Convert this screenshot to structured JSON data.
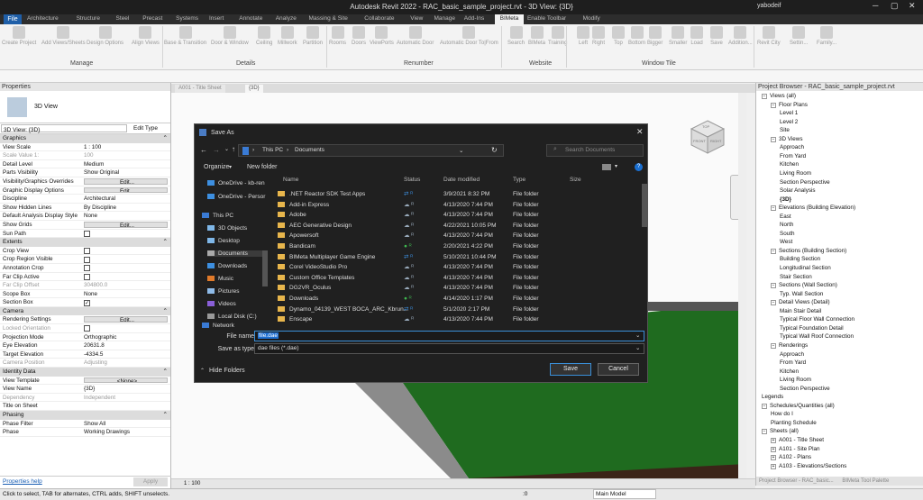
{
  "app": {
    "title": "Autodesk Revit 2022 - RAC_basic_sample_project.rvt - 3D View: {3D}",
    "user": "yabodeif"
  },
  "ribbon": {
    "file_tab": "File",
    "tabs": [
      "Architecture",
      "Structure",
      "Steel",
      "Precast",
      "Systems",
      "Insert",
      "Annotate",
      "Analyze",
      "Massing & Site",
      "Collaborate",
      "View",
      "Manage",
      "Add-Ins",
      "BIMeta",
      "Enable Toolbar",
      "Modify"
    ],
    "active_tab": "BIMeta",
    "buttons": [
      "Create Project",
      "Add Views/Sheets",
      "Design Options",
      "Align Views",
      "Base & Transition",
      "Door & Window",
      "Ceiling",
      "Millwork",
      "Partition",
      "Rooms",
      "Doors",
      "ViewPorts",
      "Automatic Door",
      "Automatic Door To|From",
      "Search",
      "BIMeta",
      "Training",
      "Left",
      "Right",
      "Top",
      "Bottom",
      "Bigger",
      "Smaller",
      "Load",
      "Save",
      "Addition...",
      "Revit City",
      "Settin...",
      "Family..."
    ],
    "panels": [
      "Manage",
      "Details",
      "Renumber",
      "Website",
      "Window Tile"
    ]
  },
  "view_tabs": [
    "A001 - Title Sheet",
    "{3D}"
  ],
  "properties": {
    "title": "Properties",
    "type_name": "3D View",
    "selector": "3D View: {3D}",
    "edit_type": "Edit Type",
    "groups": [
      {
        "name": "Graphics",
        "rows": [
          {
            "k": "View Scale",
            "v": "1 : 100"
          },
          {
            "k": "Scale Value    1:",
            "v": "100",
            "grey": true
          },
          {
            "k": "Detail Level",
            "v": "Medium"
          },
          {
            "k": "Parts Visibility",
            "v": "Show Original"
          },
          {
            "k": "Visibility/Graphics Overrides",
            "v": "Edit...",
            "btn": true
          },
          {
            "k": "Graphic Display Options",
            "v": "Edit...",
            "btn": true
          },
          {
            "k": "Discipline",
            "v": "Architectural"
          },
          {
            "k": "Show Hidden Lines",
            "v": "By Discipline"
          },
          {
            "k": "Default Analysis Display Style",
            "v": "None"
          },
          {
            "k": "Show Grids",
            "v": "Edit...",
            "btn": true
          },
          {
            "k": "Sun Path",
            "v": "",
            "cb": "off"
          }
        ]
      },
      {
        "name": "Extents",
        "rows": [
          {
            "k": "Crop View",
            "v": "",
            "cb": "off"
          },
          {
            "k": "Crop Region Visible",
            "v": "",
            "cb": "off"
          },
          {
            "k": "Annotation Crop",
            "v": "",
            "cb": "off"
          },
          {
            "k": "Far Clip Active",
            "v": "",
            "cb": "off"
          },
          {
            "k": "Far Clip Offset",
            "v": "304800.0",
            "grey": true
          },
          {
            "k": "Scope Box",
            "v": "None"
          },
          {
            "k": "Section Box",
            "v": "",
            "cb": "on"
          }
        ]
      },
      {
        "name": "Camera",
        "rows": [
          {
            "k": "Rendering Settings",
            "v": "Edit...",
            "btn": true
          },
          {
            "k": "Locked Orientation",
            "v": "",
            "cb": "off",
            "grey": true
          },
          {
            "k": "Projection Mode",
            "v": "Orthographic"
          },
          {
            "k": "Eye Elevation",
            "v": "20631.8"
          },
          {
            "k": "Target Elevation",
            "v": "-4334.5"
          },
          {
            "k": "Camera Position",
            "v": "Adjusting",
            "grey": true
          }
        ]
      },
      {
        "name": "Identity Data",
        "rows": [
          {
            "k": "View Template",
            "v": "<None>",
            "btn": true
          },
          {
            "k": "View Name",
            "v": "{3D}"
          },
          {
            "k": "Dependency",
            "v": "Independent",
            "grey": true
          },
          {
            "k": "Title on Sheet",
            "v": ""
          }
        ]
      },
      {
        "name": "Phasing",
        "rows": [
          {
            "k": "Phase Filter",
            "v": "Show All"
          },
          {
            "k": "Phase",
            "v": "Working Drawings"
          }
        ]
      }
    ],
    "help_link": "Properties help",
    "apply": "Apply"
  },
  "browser": {
    "title": "Project Browser - RAC_basic_sample_project.rvt",
    "items": [
      {
        "t": "Views (all)",
        "lvl": 0,
        "tg": "−"
      },
      {
        "t": "Floor Plans",
        "lvl": 1,
        "tg": "−"
      },
      {
        "t": "Level 1",
        "lvl": 2
      },
      {
        "t": "Level 2",
        "lvl": 2
      },
      {
        "t": "Site",
        "lvl": 2
      },
      {
        "t": "3D Views",
        "lvl": 1,
        "tg": "−"
      },
      {
        "t": "Approach",
        "lvl": 2
      },
      {
        "t": "From Yard",
        "lvl": 2
      },
      {
        "t": "Kitchen",
        "lvl": 2
      },
      {
        "t": "Living Room",
        "lvl": 2
      },
      {
        "t": "Section Perspective",
        "lvl": 2
      },
      {
        "t": "Solar Analysis",
        "lvl": 2
      },
      {
        "t": "{3D}",
        "lvl": 2,
        "bold": true
      },
      {
        "t": "Elevations (Building Elevation)",
        "lvl": 1,
        "tg": "−"
      },
      {
        "t": "East",
        "lvl": 2
      },
      {
        "t": "North",
        "lvl": 2
      },
      {
        "t": "South",
        "lvl": 2
      },
      {
        "t": "West",
        "lvl": 2
      },
      {
        "t": "Sections (Building Section)",
        "lvl": 1,
        "tg": "−"
      },
      {
        "t": "Building Section",
        "lvl": 2
      },
      {
        "t": "Longitudinal Section",
        "lvl": 2
      },
      {
        "t": "Stair Section",
        "lvl": 2
      },
      {
        "t": "Sections (Wall Section)",
        "lvl": 1,
        "tg": "−"
      },
      {
        "t": "Typ. Wall Section",
        "lvl": 2
      },
      {
        "t": "Detail Views (Detail)",
        "lvl": 1,
        "tg": "−"
      },
      {
        "t": "Main Stair Detail",
        "lvl": 2
      },
      {
        "t": "Typical Floor Wall Connection",
        "lvl": 2
      },
      {
        "t": "Typical Foundation Detail",
        "lvl": 2
      },
      {
        "t": "Typical Wall Roof Connection",
        "lvl": 2
      },
      {
        "t": "Renderings",
        "lvl": 1,
        "tg": "−"
      },
      {
        "t": "Approach",
        "lvl": 2
      },
      {
        "t": "From Yard",
        "lvl": 2
      },
      {
        "t": "Kitchen",
        "lvl": 2
      },
      {
        "t": "Living Room",
        "lvl": 2
      },
      {
        "t": "Section Perspective",
        "lvl": 2
      },
      {
        "t": "Legends",
        "lvl": 0
      },
      {
        "t": "Schedules/Quantities (all)",
        "lvl": 0,
        "tg": "−"
      },
      {
        "t": "How do I",
        "lvl": 1
      },
      {
        "t": "Planting Schedule",
        "lvl": 1
      },
      {
        "t": "Sheets (all)",
        "lvl": 0,
        "tg": "−"
      },
      {
        "t": "A001 - Title Sheet",
        "lvl": 1,
        "tg": "+"
      },
      {
        "t": "A101 - Site Plan",
        "lvl": 1,
        "tg": "+"
      },
      {
        "t": "A102 - Plans",
        "lvl": 1,
        "tg": "+"
      },
      {
        "t": "A103 - Elevations/Sections",
        "lvl": 1,
        "tg": "+"
      }
    ],
    "bottom_tabs": [
      "Project Browser - RAC_basic...",
      "BIMeta Tool Palette"
    ]
  },
  "dialog": {
    "title": "Save As",
    "breadcrumb": [
      "This PC",
      "Documents"
    ],
    "search_placeholder": "Search Documents",
    "organize": "Organize",
    "new_folder": "New folder",
    "columns": [
      "Name",
      "Status",
      "Date modified",
      "Type",
      "Size"
    ],
    "nav": [
      "OneDrive - kb-ren",
      "OneDrive - Persor",
      "This PC",
      "3D Objects",
      "Desktop",
      "Documents",
      "Downloads",
      "Music",
      "Pictures",
      "Videos",
      "Local Disk (C:)",
      "Network"
    ],
    "files": [
      {
        "name": ".NET Reactor SDK Test Apps",
        "status": "sync",
        "date": "3/9/2021 8:32 PM",
        "type": "File folder"
      },
      {
        "name": "Add-in Express",
        "status": "cloud",
        "date": "4/13/2020 7:44 PM",
        "type": "File folder"
      },
      {
        "name": "Adobe",
        "status": "cloud",
        "date": "4/13/2020 7:44 PM",
        "type": "File folder"
      },
      {
        "name": "AEC Generative Design",
        "status": "cloud",
        "date": "4/22/2021 10:05 PM",
        "type": "File folder"
      },
      {
        "name": "Apowersoft",
        "status": "cloud",
        "date": "4/13/2020 7:44 PM",
        "type": "File folder"
      },
      {
        "name": "Bandicam",
        "status": "ok",
        "date": "2/20/2021 4:22 PM",
        "type": "File folder"
      },
      {
        "name": "BIMeta Multiplayer Game Engine",
        "status": "sync",
        "date": "5/10/2021 10:44 PM",
        "type": "File folder"
      },
      {
        "name": "Corel VideoStudio Pro",
        "status": "cloud",
        "date": "4/13/2020 7:44 PM",
        "type": "File folder"
      },
      {
        "name": "Custom Office Templates",
        "status": "cloud",
        "date": "4/13/2020 7:44 PM",
        "type": "File folder"
      },
      {
        "name": "DG2VR_Oculus",
        "status": "cloud",
        "date": "4/13/2020 7:44 PM",
        "type": "File folder"
      },
      {
        "name": "Downloads",
        "status": "ok",
        "date": "4/14/2020 1:17 PM",
        "type": "File folder"
      },
      {
        "name": "Dynamo_04139_WEST BOCA_ARC_Kbrun...",
        "status": "sync",
        "date": "5/1/2020 2:17 PM",
        "type": "File folder"
      },
      {
        "name": "Enscape",
        "status": "cloud",
        "date": "4/13/2020 7:44 PM",
        "type": "File folder"
      }
    ],
    "file_name_label": "File name:",
    "file_name_value": "file.dae",
    "save_type_label": "Save as type:",
    "save_type_value": "dae files (*.dae)",
    "hide_folders": "Hide Folders",
    "save": "Save",
    "cancel": "Cancel"
  },
  "viewcube": {
    "top": "TOP",
    "front": "FRONT",
    "right": "RIGHT"
  },
  "scale_bar": "1 : 100",
  "status_bar": {
    "hint": "Click to select, TAB for alternates, CTRL adds, SHIFT unselects.",
    "model": "Main Model",
    "zero": ":0"
  }
}
